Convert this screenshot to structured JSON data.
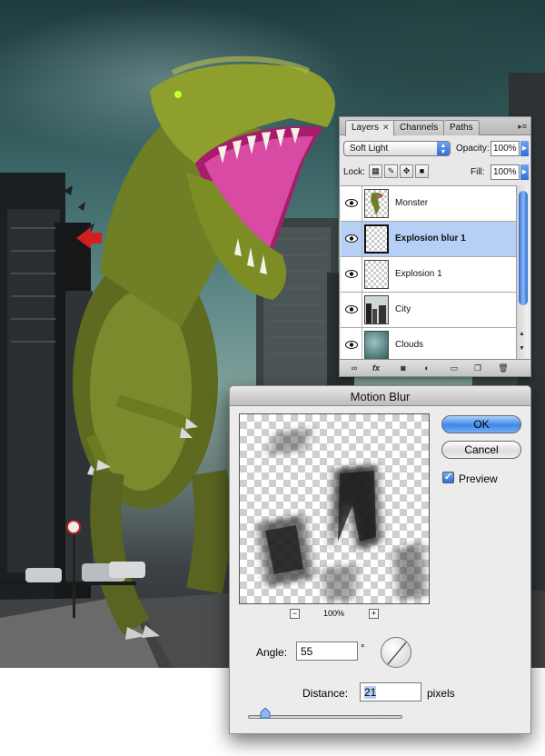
{
  "layers_panel": {
    "tabs": [
      {
        "label": "Layers",
        "close": "✕"
      },
      {
        "label": "Channels"
      },
      {
        "label": "Paths"
      }
    ],
    "blend_mode": "Soft Light",
    "opacity_label": "Opacity:",
    "opacity_value": "100%",
    "lock_label": "Lock:",
    "fill_label": "Fill:",
    "fill_value": "100%",
    "layers": [
      {
        "name": "Monster",
        "visible": true,
        "selected": false
      },
      {
        "name": "Explosion blur 1",
        "visible": true,
        "selected": true
      },
      {
        "name": "Explosion 1",
        "visible": true,
        "selected": false
      },
      {
        "name": "City",
        "visible": true,
        "selected": false
      },
      {
        "name": "Clouds",
        "visible": true,
        "selected": false
      }
    ],
    "bottom_icons": [
      "link-icon",
      "fx-icon",
      "mask-icon",
      "adjustment-icon",
      "folder-icon",
      "new-layer-icon",
      "trash-icon"
    ]
  },
  "motion_blur": {
    "title": "Motion Blur",
    "ok_label": "OK",
    "cancel_label": "Cancel",
    "preview_label": "Preview",
    "preview_checked": true,
    "zoom_minus": "−",
    "zoom_plus": "+",
    "zoom_level": "100%",
    "angle_label": "Angle:",
    "angle_value": "55",
    "degree_symbol": "°",
    "distance_label": "Distance:",
    "distance_value": "21",
    "pixels_label": "pixels"
  },
  "colors": {
    "selected_layer": "#b6d0f5",
    "aqua_blue": "#3d86ea",
    "arrow_red": "#d21f1f"
  }
}
